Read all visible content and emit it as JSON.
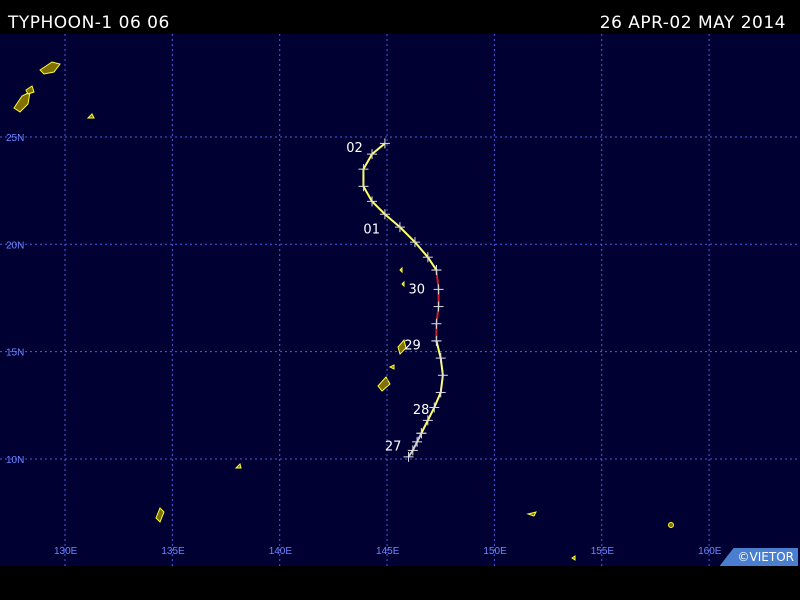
{
  "header": {
    "title": "TYPHOON-1 06 06",
    "date_range": "26 APR-02 MAY 2014"
  },
  "map": {
    "lat_labels": [
      "10N",
      "15N",
      "20N",
      "25N"
    ],
    "lon_labels": [
      "130E",
      "135E",
      "140E",
      "145E",
      "150E",
      "155E",
      "160E"
    ],
    "date_labels": [
      "27",
      "28",
      "29",
      "30",
      "01",
      "02"
    ],
    "credit": "©VIETOR"
  },
  "colors": {
    "background": "#000033",
    "grid": "#4b5ee6",
    "track_weak": "#ffff66",
    "track_typhoon": "#cc2222",
    "track_depression": "#cccccc"
  },
  "track": {
    "segments": [
      {
        "intensity": "depression",
        "points": [
          [
            146.0,
            10.1
          ],
          [
            146.2,
            10.4
          ],
          [
            146.4,
            10.8
          ],
          [
            146.6,
            11.2
          ]
        ]
      },
      {
        "intensity": "storm",
        "points": [
          [
            146.6,
            11.2
          ],
          [
            146.9,
            11.8
          ],
          [
            147.2,
            12.4
          ],
          [
            147.5,
            13.1
          ],
          [
            147.6,
            13.9
          ],
          [
            147.5,
            14.7
          ],
          [
            147.3,
            15.5
          ]
        ]
      },
      {
        "intensity": "typhoon",
        "points": [
          [
            147.3,
            15.5
          ],
          [
            147.3,
            16.3
          ],
          [
            147.4,
            17.1
          ],
          [
            147.4,
            17.9
          ],
          [
            147.3,
            18.8
          ]
        ]
      },
      {
        "intensity": "storm",
        "points": [
          [
            147.3,
            18.8
          ],
          [
            146.9,
            19.4
          ],
          [
            146.3,
            20.1
          ],
          [
            145.6,
            20.8
          ],
          [
            144.9,
            21.4
          ],
          [
            144.3,
            22.0
          ],
          [
            143.9,
            22.7
          ],
          [
            143.9,
            23.5
          ],
          [
            144.3,
            24.2
          ],
          [
            144.9,
            24.7
          ]
        ]
      }
    ]
  }
}
